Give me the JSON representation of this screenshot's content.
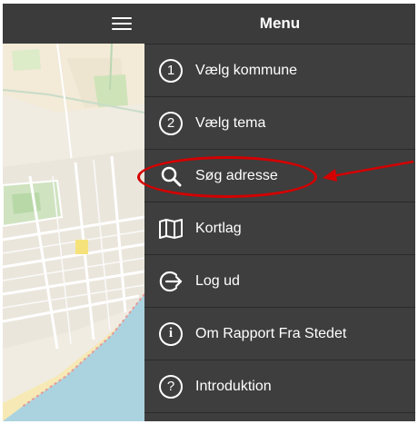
{
  "header": {
    "title": "Menu"
  },
  "menu": {
    "items": [
      {
        "label": "Vælg kommune",
        "icon": "number-1-icon",
        "badge": "1"
      },
      {
        "label": "Vælg tema",
        "icon": "number-2-icon",
        "badge": "2"
      },
      {
        "label": "Søg adresse",
        "icon": "search-icon"
      },
      {
        "label": "Kortlag",
        "icon": "map-icon"
      },
      {
        "label": "Log ud",
        "icon": "logout-icon"
      },
      {
        "label": "Om Rapport Fra Stedet",
        "icon": "info-icon"
      },
      {
        "label": "Introduktion",
        "icon": "help-icon"
      }
    ]
  },
  "annotation": {
    "color": "#d40000",
    "target": "Søg adresse"
  },
  "colors": {
    "panel": "#3e3e3e",
    "header": "#3b3b3b",
    "text": "#ffffff",
    "map_water": "#aad3df",
    "map_land": "#f0ece2"
  }
}
